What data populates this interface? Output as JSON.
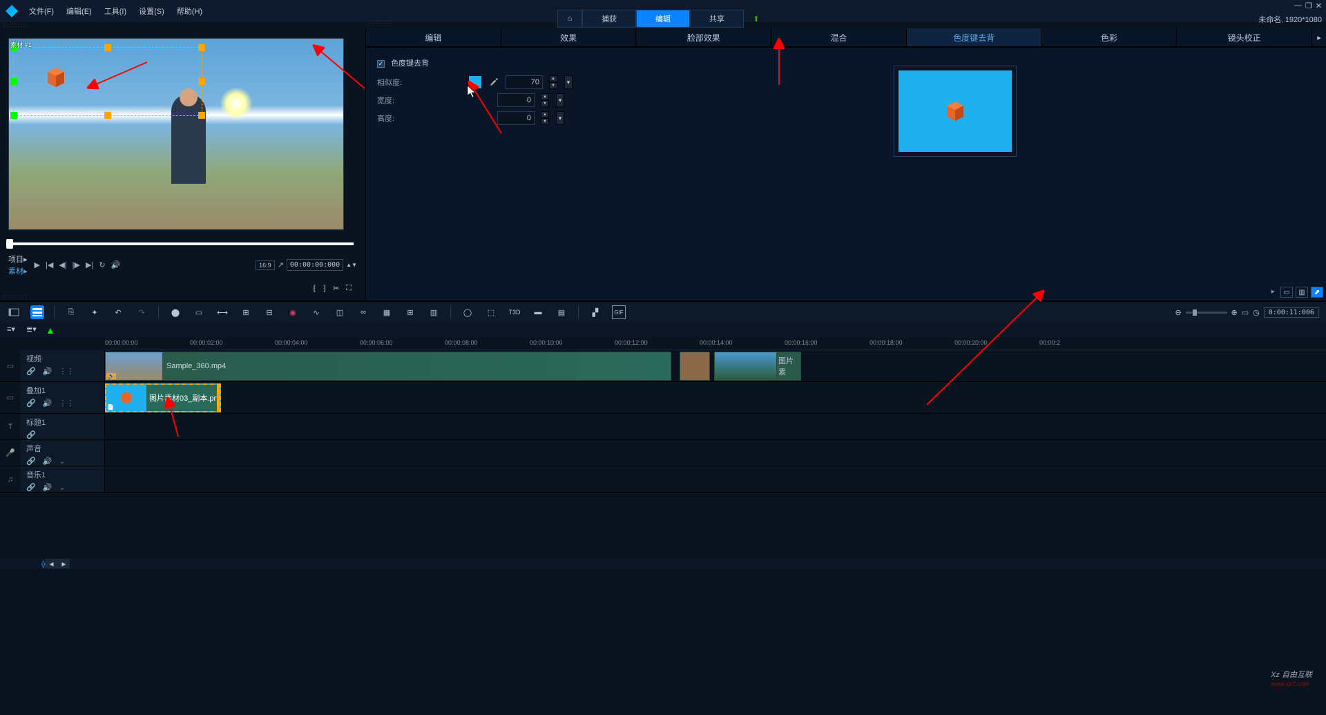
{
  "menubar": {
    "file": "文件(F)",
    "edit": "编辑(E)",
    "tools": "工具(I)",
    "settings": "设置(S)",
    "help": "帮助(H)"
  },
  "modes": {
    "capture": "捕获",
    "edit": "编辑",
    "share": "共享"
  },
  "project": {
    "title": "未命名",
    "res": "1920*1080"
  },
  "preview": {
    "clip_label": "素材 #1",
    "project_label": "项目▸",
    "clip_tab": "素材▸",
    "ratio": "16:9",
    "timecode": "00:00:00:000"
  },
  "effect_tabs": {
    "edit": "编辑",
    "effect": "效果",
    "face": "脸部效果",
    "blend": "混合",
    "chroma": "色度键去背",
    "color": "色彩",
    "lens": "镜头校正"
  },
  "chroma": {
    "enable": "色度键去背",
    "similarity": "相似度:",
    "width": "宽度:",
    "height": "高度:",
    "val_sim": "70",
    "val_w": "0",
    "val_h": "0",
    "color": "#1fb0f0"
  },
  "timeline": {
    "marks": [
      "00:00:00:00",
      "00:00:02:00",
      "00:00:04:00",
      "00:00:06:00",
      "00:00:08:00",
      "00:00:10:00",
      "00:00:12:00",
      "00:00:14:00",
      "00:00:16:00",
      "00:00:18:00",
      "00:00:20:00",
      "00:00:2"
    ],
    "tc": "0:00:11:006",
    "tracks": {
      "video": "视频",
      "overlay1": "叠加1",
      "title1": "标题1",
      "sound": "声音",
      "music1": "音乐1"
    },
    "clips": {
      "main": "Sample_360.mp4",
      "overlay": "图片素材03_副本.pn",
      "img3": "图片素"
    }
  },
  "watermark": {
    "brand": "Xz 自由互联",
    "url": "www.xz7.com"
  }
}
